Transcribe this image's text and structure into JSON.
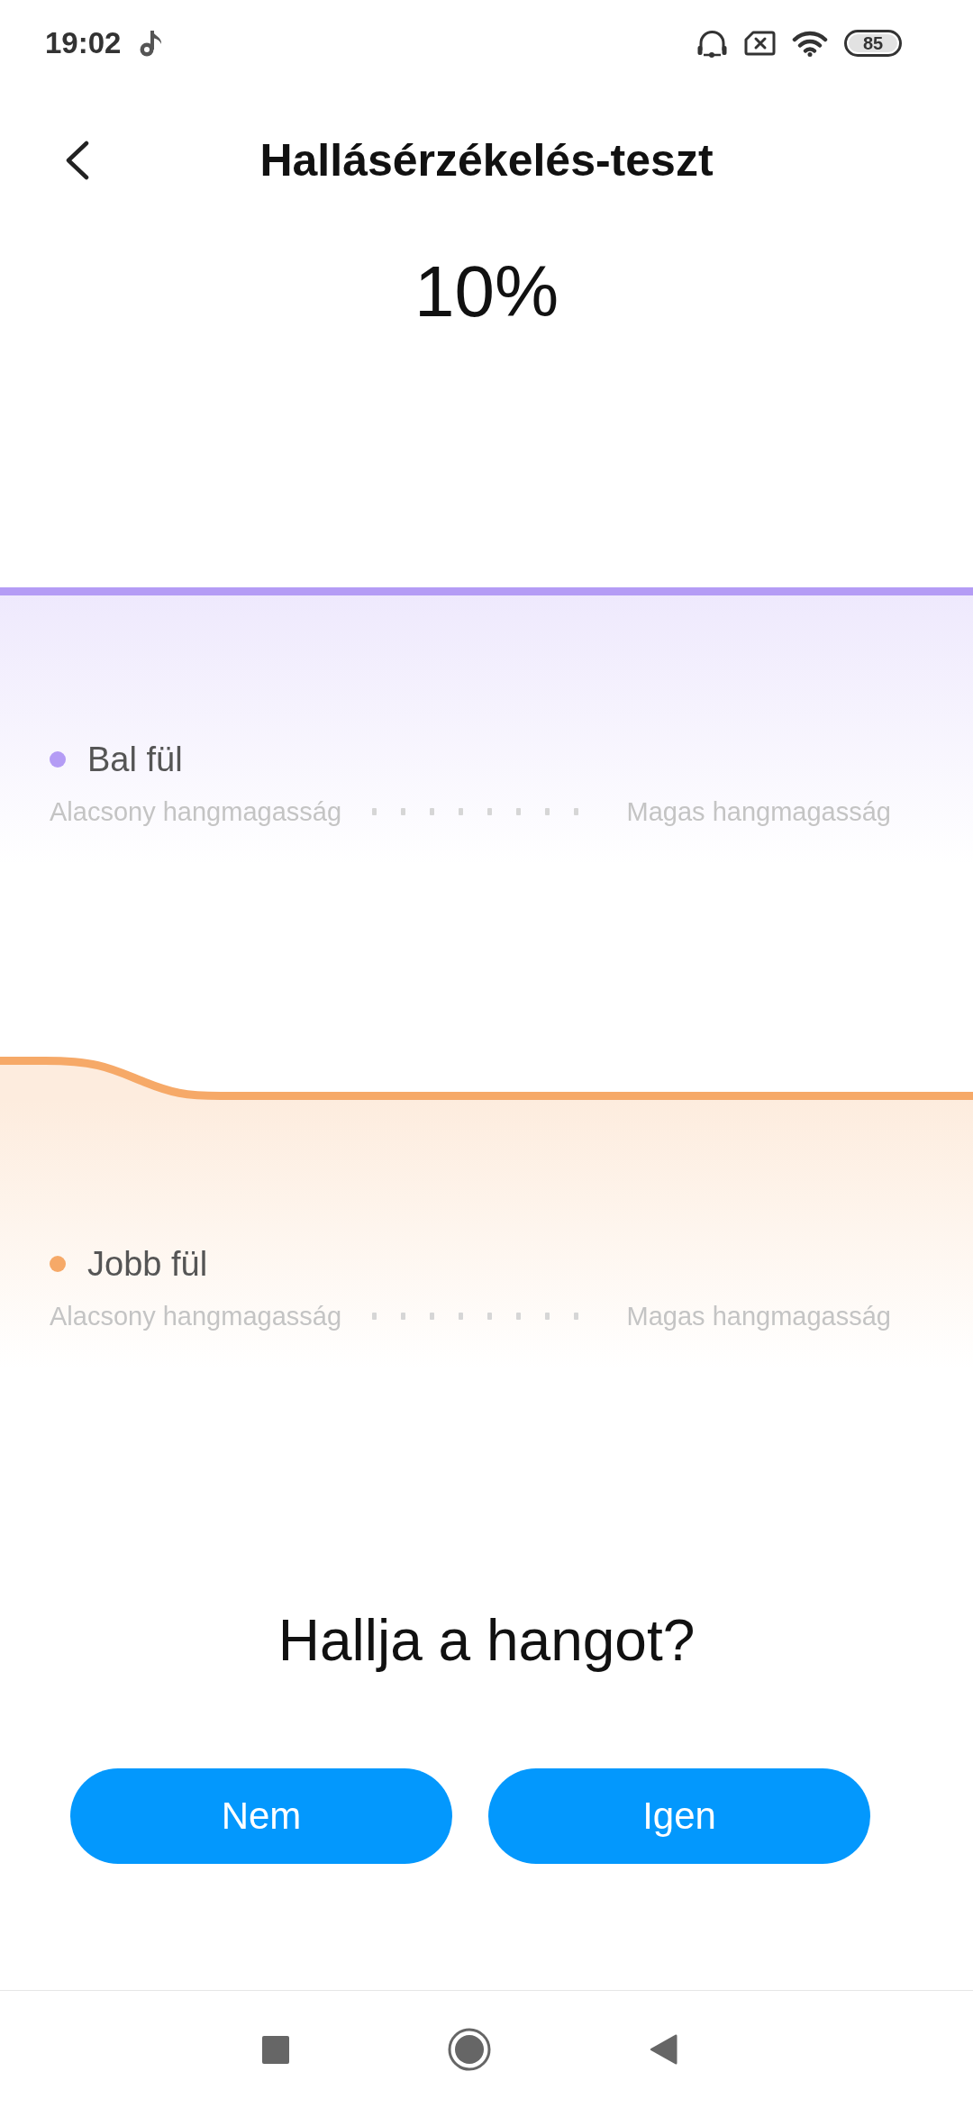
{
  "status_bar": {
    "time": "19:02",
    "battery": "85"
  },
  "header": {
    "title": "Hallásérzékelés-teszt"
  },
  "progress": "10%",
  "ears": [
    {
      "label": "Bal fül",
      "color": "#b49cf5",
      "low_label": "Alacsony hangmagasság",
      "high_label": "Magas hangmagasság"
    },
    {
      "label": "Jobb fül",
      "color": "#f6a968",
      "low_label": "Alacsony hangmagasság",
      "high_label": "Magas hangmagasság"
    }
  ],
  "question": "Hallja a hangot?",
  "buttons": [
    {
      "label": "Nem"
    },
    {
      "label": "Igen"
    }
  ]
}
